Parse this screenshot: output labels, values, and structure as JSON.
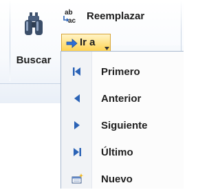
{
  "ribbon": {
    "find_button": {
      "label": "Buscar",
      "icon": "binoculars-icon"
    },
    "replace_button": {
      "label": "Reemplazar",
      "icon": "replace-ab-ac-icon"
    },
    "goto_button": {
      "label": "Ir a",
      "icon": "arrow-right-icon",
      "dropdown_icon": "chevron-down-icon"
    }
  },
  "goto_menu": {
    "items": [
      {
        "label": "Primero",
        "icon": "first-record-icon"
      },
      {
        "label": "Anterior",
        "icon": "previous-record-icon"
      },
      {
        "label": "Siguiente",
        "icon": "next-record-icon"
      },
      {
        "label": "Último",
        "icon": "last-record-icon"
      },
      {
        "label": "Nuevo",
        "icon": "new-record-icon"
      }
    ]
  },
  "colors": {
    "accent_icon_blue": "#2b63b6",
    "active_button_gold": "#ffd24e",
    "menu_border": "#a9b9cf"
  }
}
